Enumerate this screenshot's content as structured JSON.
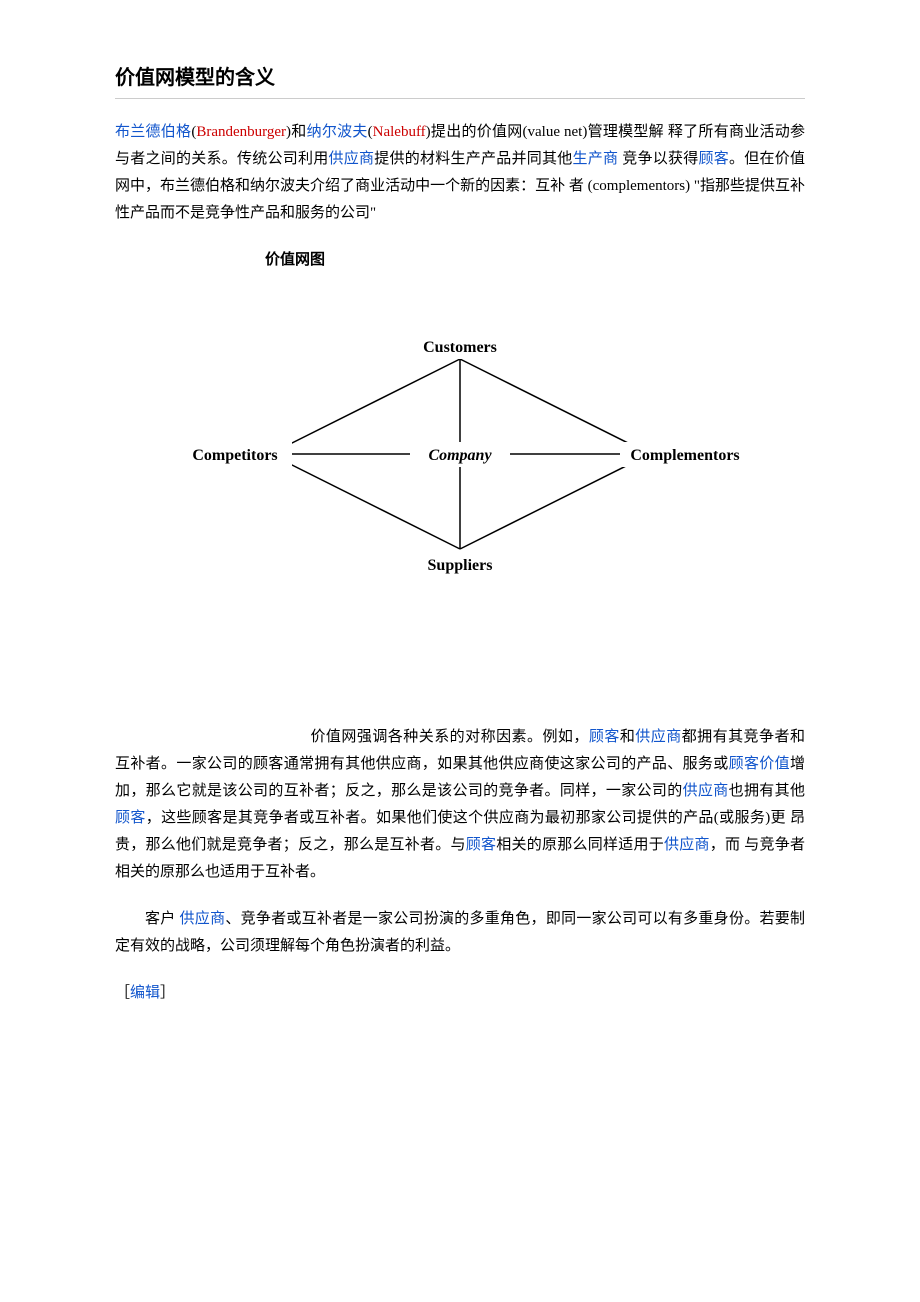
{
  "title": "价值网模型的含义",
  "p1": {
    "t1": "布兰德伯格",
    "t2": "(",
    "t3": "Brandenburger",
    "t4": ")和",
    "t5": "纳尔波夫",
    "t6": "(",
    "t7": "Nalebuff",
    "t8": ")提出的价值网(value  net)管理模型解  释了所有商业活动参与者之间的关系。传统公司利用",
    "t9": "供应商",
    "t10": "提供的材料生产产品并同其他",
    "t11": "生产商",
    "t12": " 竞争以获得",
    "t13": "顾客",
    "t14": "。但在价值网中，布兰德伯格和纳尔波夫介绍了商业活动中一个新的因素：互补   者 (complementors) \"指那些提供互补性产品而不是竞争性产品和服务的公司\""
  },
  "diagram": {
    "title": "价值网图",
    "top": "Customers",
    "left": "Competitors",
    "center": "Company",
    "right": "Complementors",
    "bottom": "Suppliers"
  },
  "p2": {
    "t0": "价值网强调各种关系的对称因素。例如，",
    "t1": "顾客",
    "t2": "和",
    "t3": "供应商",
    "t4": "都拥有其竞争者和互补者。一家公司的顾客通常拥有其他供应商，如果其他供应商使这家公司的产品、服务或",
    "t5": "顾客价值",
    "t6": "增加，那么它就是该公司的互补者；反之，那么是该公司的竞争者。同样，一家公司的",
    "t7": "供应商",
    "t8": "也拥有其他",
    "t9": "顾客",
    "t10": "，这些顾客是其竞争者或互补者。如果他们使这个供应商为最初那家公司提供的产品(或服务)更 昂贵，那么他们就是竞争者；反之，那么是互补者。与",
    "t11": "顾客",
    "t12": "相关的原那么同样适用于",
    "t13": "供应商",
    "t14": "，而 与竞争者相关的原那么也适用于互补者。"
  },
  "p3": {
    "t1": "客户  ",
    "t2": "供应商",
    "t3": "、竞争者或互补者是一家公司扮演的多重角色，即同一家公司可以有多重身份。若要制定有效的战略，公司须理解每个角色扮演者的利益。"
  },
  "edit": {
    "t1": "［",
    "t2": "编辑",
    "t3": "］"
  }
}
